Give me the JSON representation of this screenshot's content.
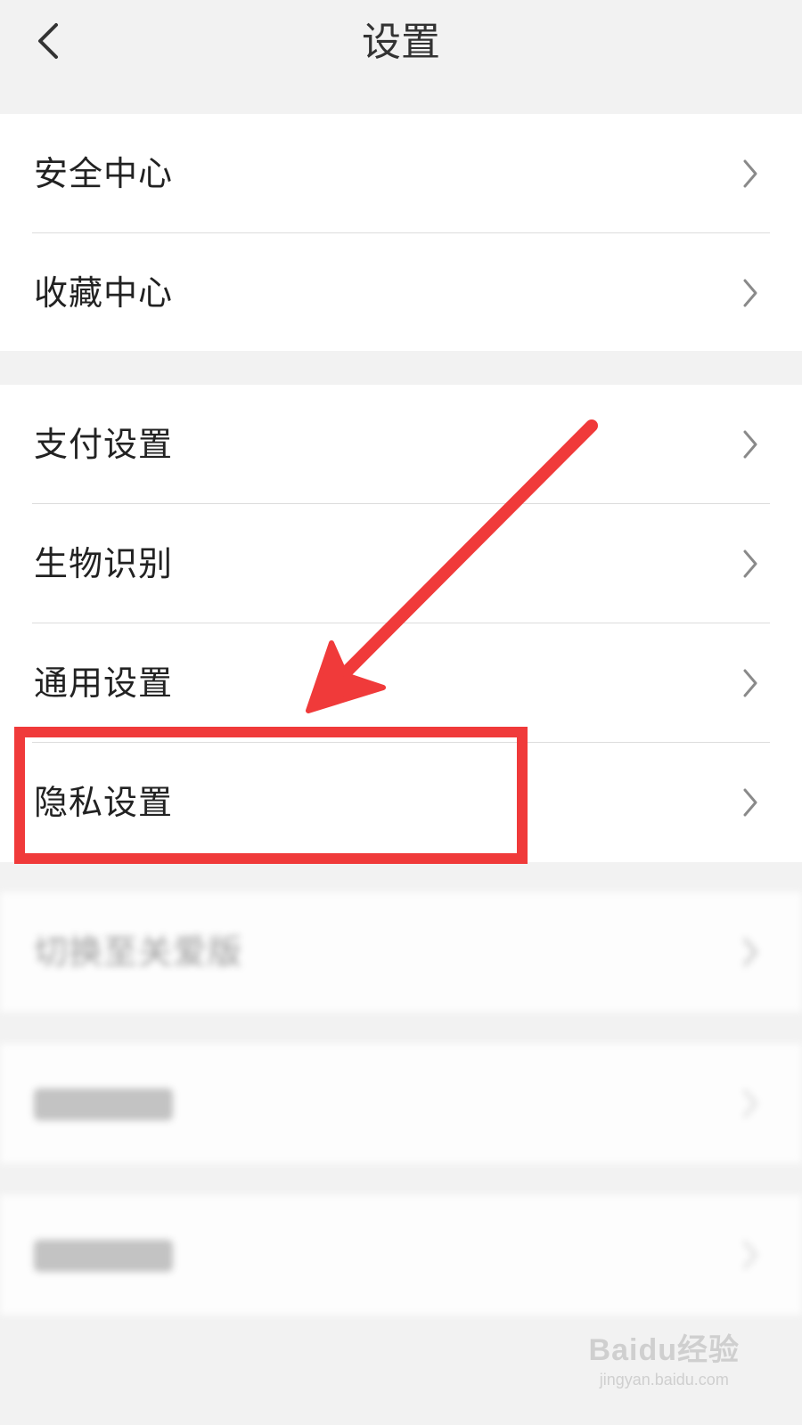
{
  "header": {
    "title": "设置"
  },
  "group1": {
    "items": [
      {
        "label": "安全中心"
      },
      {
        "label": "收藏中心"
      }
    ]
  },
  "group2": {
    "items": [
      {
        "label": "支付设置"
      },
      {
        "label": "生物识别"
      },
      {
        "label": "通用设置"
      },
      {
        "label": "隐私设置"
      }
    ]
  },
  "group3": {
    "items": [
      {
        "label": "切换至关爱版"
      }
    ]
  },
  "watermark": {
    "brand": "Baidu经验",
    "url": "jingyan.baidu.com"
  },
  "colors": {
    "annotation": "#f03a3a",
    "background": "#f2f2f2",
    "row_bg": "#ffffff"
  },
  "icons": {
    "back": "chevron-left-icon",
    "row": "chevron-right-icon",
    "annotation": "arrow-icon"
  }
}
